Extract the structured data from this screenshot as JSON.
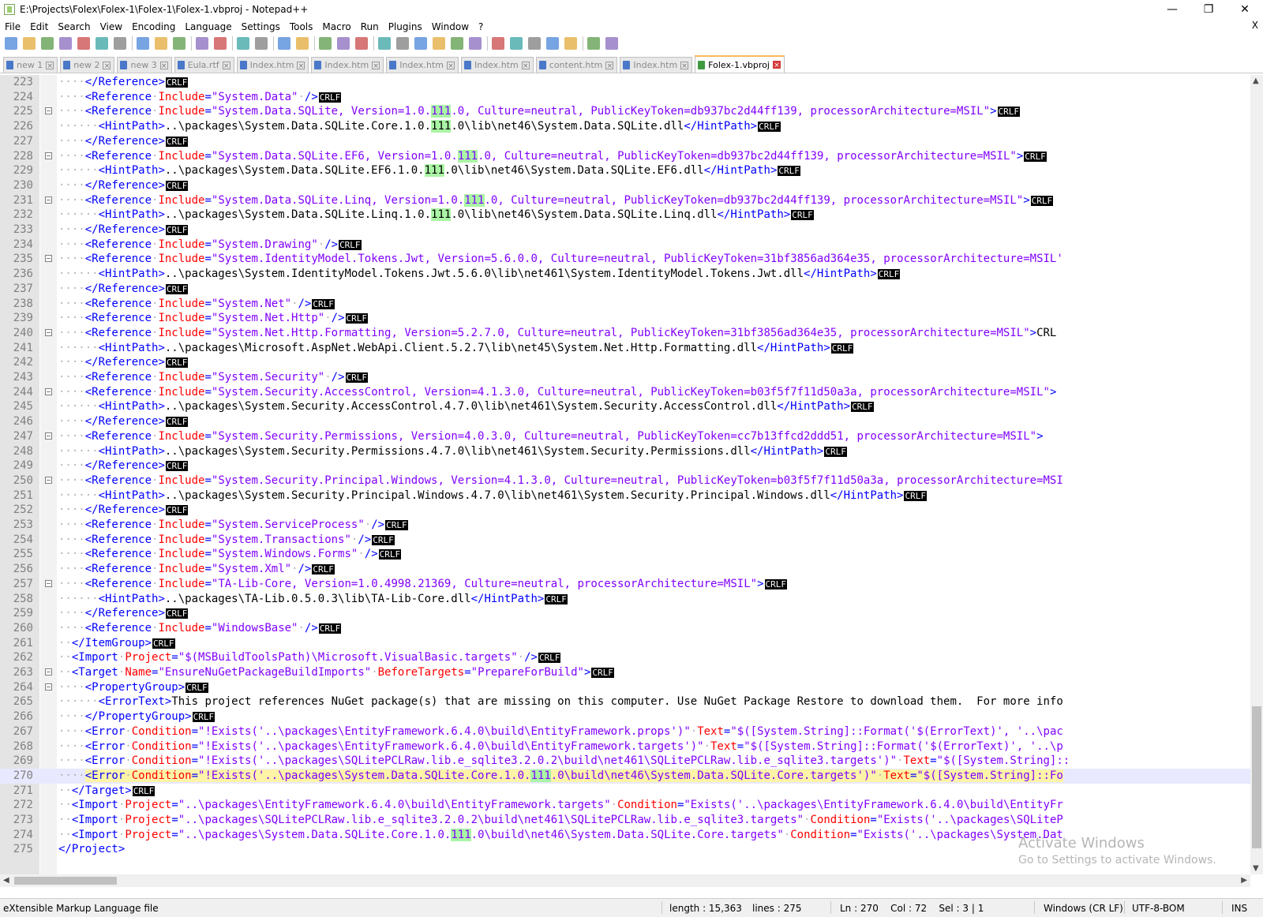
{
  "window": {
    "title": "E:\\Projects\\Folex\\Folex-1\\Folex-1\\Folex-1.vbproj - Notepad++",
    "minimize": "—",
    "maximize": "❐",
    "close": "✕"
  },
  "menu": {
    "items": [
      "File",
      "Edit",
      "Search",
      "View",
      "Encoding",
      "Language",
      "Settings",
      "Tools",
      "Macro",
      "Run",
      "Plugins",
      "Window",
      "?"
    ],
    "close_doc": "X"
  },
  "toolbar": {
    "icons": [
      "new-file-icon",
      "open-file-icon",
      "save-icon",
      "save-all-icon",
      "close-icon",
      "close-all-icon",
      "print-icon",
      "cut-icon",
      "copy-icon",
      "paste-icon",
      "undo-icon",
      "redo-icon",
      "find-icon",
      "replace-icon",
      "zoom-in-icon",
      "zoom-out-icon",
      "sync-vertical-icon",
      "sync-horizontal-icon",
      "word-wrap-icon",
      "show-all-chars-icon",
      "indent-guide-icon",
      "doc-map-icon",
      "function-list-icon",
      "folder-workspace-icon",
      "monitor-icon",
      "record-macro-icon",
      "stop-macro-icon",
      "play-macro-icon",
      "run-macro-multiple-icon",
      "save-macro-icon",
      "spellcheck-icon",
      "spellcheck-settings-icon"
    ]
  },
  "tabs": [
    {
      "label": "new 1",
      "active": false
    },
    {
      "label": "new 2",
      "active": false
    },
    {
      "label": "new 3",
      "active": false
    },
    {
      "label": "Eula.rtf",
      "active": false
    },
    {
      "label": "Index.htm",
      "active": false
    },
    {
      "label": "Index.htm",
      "active": false
    },
    {
      "label": "Index.htm",
      "active": false
    },
    {
      "label": "Index.htm",
      "active": false
    },
    {
      "label": "content.htm",
      "active": false
    },
    {
      "label": "Index.htm",
      "active": false
    },
    {
      "label": "Folex-1.vbproj",
      "active": true
    }
  ],
  "colors": {
    "tag": "#0000ff",
    "attr": "#ff0000",
    "value": "#8000ff",
    "text": "#000000",
    "whitespace_dot": "#b4b4b4",
    "eol_bg": "#000000",
    "eol_fg": "#ffffff",
    "smart_highlight": "#aaf5a5",
    "current_line": "#e8e8ff",
    "selection": "#fdf4a8"
  },
  "editor": {
    "current_line": 270,
    "lines": [
      {
        "n": 223,
        "fold": false,
        "ws": "....",
        "code": "</Reference>",
        "eol": true
      },
      {
        "n": 224,
        "fold": false,
        "ws": "....",
        "code": "<Reference Include=\"System.Data\" />",
        "eol": true
      },
      {
        "n": 225,
        "fold": true,
        "ws": "....",
        "code": "<Reference Include=\"System.Data.SQLite, Version=1.0.111.0, Culture=neutral, PublicKeyToken=db937bc2d44ff139, processorArchitecture=MSIL\">",
        "eol": true
      },
      {
        "n": 226,
        "fold": false,
        "ws": "......",
        "code": "<HintPath>..\\packages\\System.Data.SQLite.Core.1.0.111.0\\lib\\net46\\System.Data.SQLite.dll</HintPath>",
        "eol": true
      },
      {
        "n": 227,
        "fold": false,
        "ws": "....",
        "code": "</Reference>",
        "eol": true
      },
      {
        "n": 228,
        "fold": true,
        "ws": "....",
        "code": "<Reference Include=\"System.Data.SQLite.EF6, Version=1.0.111.0, Culture=neutral, PublicKeyToken=db937bc2d44ff139, processorArchitecture=MSIL\">",
        "eol": true
      },
      {
        "n": 229,
        "fold": false,
        "ws": "......",
        "code": "<HintPath>..\\packages\\System.Data.SQLite.EF6.1.0.111.0\\lib\\net46\\System.Data.SQLite.EF6.dll</HintPath>",
        "eol": true
      },
      {
        "n": 230,
        "fold": false,
        "ws": "....",
        "code": "</Reference>",
        "eol": true
      },
      {
        "n": 231,
        "fold": true,
        "ws": "....",
        "code": "<Reference Include=\"System.Data.SQLite.Linq, Version=1.0.111.0, Culture=neutral, PublicKeyToken=db937bc2d44ff139, processorArchitecture=MSIL\">",
        "eol": true
      },
      {
        "n": 232,
        "fold": false,
        "ws": "......",
        "code": "<HintPath>..\\packages\\System.Data.SQLite.Linq.1.0.111.0\\lib\\net46\\System.Data.SQLite.Linq.dll</HintPath>",
        "eol": true
      },
      {
        "n": 233,
        "fold": false,
        "ws": "....",
        "code": "</Reference>",
        "eol": true
      },
      {
        "n": 234,
        "fold": false,
        "ws": "....",
        "code": "<Reference Include=\"System.Drawing\" />",
        "eol": true
      },
      {
        "n": 235,
        "fold": true,
        "ws": "....",
        "code": "<Reference Include=\"System.IdentityModel.Tokens.Jwt, Version=5.6.0.0, Culture=neutral, PublicKeyToken=31bf3856ad364e35, processorArchitecture=MSIL'",
        "eol": false
      },
      {
        "n": 236,
        "fold": false,
        "ws": "......",
        "code": "<HintPath>..\\packages\\System.IdentityModel.Tokens.Jwt.5.6.0\\lib\\net461\\System.IdentityModel.Tokens.Jwt.dll</HintPath>",
        "eol": true
      },
      {
        "n": 237,
        "fold": false,
        "ws": "....",
        "code": "</Reference>",
        "eol": true
      },
      {
        "n": 238,
        "fold": false,
        "ws": "....",
        "code": "<Reference Include=\"System.Net\" />",
        "eol": true
      },
      {
        "n": 239,
        "fold": false,
        "ws": "....",
        "code": "<Reference Include=\"System.Net.Http\" />",
        "eol": true
      },
      {
        "n": 240,
        "fold": true,
        "ws": "....",
        "code": "<Reference Include=\"System.Net.Http.Formatting, Version=5.2.7.0, Culture=neutral, PublicKeyToken=31bf3856ad364e35, processorArchitecture=MSIL\">CRL",
        "eol": false
      },
      {
        "n": 241,
        "fold": false,
        "ws": "......",
        "code": "<HintPath>..\\packages\\Microsoft.AspNet.WebApi.Client.5.2.7\\lib\\net45\\System.Net.Http.Formatting.dll</HintPath>",
        "eol": true
      },
      {
        "n": 242,
        "fold": false,
        "ws": "....",
        "code": "</Reference>",
        "eol": true
      },
      {
        "n": 243,
        "fold": false,
        "ws": "....",
        "code": "<Reference Include=\"System.Security\" />",
        "eol": true
      },
      {
        "n": 244,
        "fold": true,
        "ws": "....",
        "code": "<Reference Include=\"System.Security.AccessControl, Version=4.1.3.0, Culture=neutral, PublicKeyToken=b03f5f7f11d50a3a, processorArchitecture=MSIL\">",
        "eol": false
      },
      {
        "n": 245,
        "fold": false,
        "ws": "......",
        "code": "<HintPath>..\\packages\\System.Security.AccessControl.4.7.0\\lib\\net461\\System.Security.AccessControl.dll</HintPath>",
        "eol": true
      },
      {
        "n": 246,
        "fold": false,
        "ws": "....",
        "code": "</Reference>",
        "eol": true
      },
      {
        "n": 247,
        "fold": true,
        "ws": "....",
        "code": "<Reference Include=\"System.Security.Permissions, Version=4.0.3.0, Culture=neutral, PublicKeyToken=cc7b13ffcd2ddd51, processorArchitecture=MSIL\">",
        "eol": false
      },
      {
        "n": 248,
        "fold": false,
        "ws": "......",
        "code": "<HintPath>..\\packages\\System.Security.Permissions.4.7.0\\lib\\net461\\System.Security.Permissions.dll</HintPath>",
        "eol": true
      },
      {
        "n": 249,
        "fold": false,
        "ws": "....",
        "code": "</Reference>",
        "eol": true
      },
      {
        "n": 250,
        "fold": true,
        "ws": "....",
        "code": "<Reference Include=\"System.Security.Principal.Windows, Version=4.1.3.0, Culture=neutral, PublicKeyToken=b03f5f7f11d50a3a, processorArchitecture=MSI",
        "eol": false
      },
      {
        "n": 251,
        "fold": false,
        "ws": "......",
        "code": "<HintPath>..\\packages\\System.Security.Principal.Windows.4.7.0\\lib\\net461\\System.Security.Principal.Windows.dll</HintPath>",
        "eol": true
      },
      {
        "n": 252,
        "fold": false,
        "ws": "....",
        "code": "</Reference>",
        "eol": true
      },
      {
        "n": 253,
        "fold": false,
        "ws": "....",
        "code": "<Reference Include=\"System.ServiceProcess\" />",
        "eol": true
      },
      {
        "n": 254,
        "fold": false,
        "ws": "....",
        "code": "<Reference Include=\"System.Transactions\" />",
        "eol": true
      },
      {
        "n": 255,
        "fold": false,
        "ws": "....",
        "code": "<Reference Include=\"System.Windows.Forms\" />",
        "eol": true
      },
      {
        "n": 256,
        "fold": false,
        "ws": "....",
        "code": "<Reference Include=\"System.Xml\" />",
        "eol": true
      },
      {
        "n": 257,
        "fold": true,
        "ws": "....",
        "code": "<Reference Include=\"TA-Lib-Core, Version=1.0.4998.21369, Culture=neutral, processorArchitecture=MSIL\">",
        "eol": true
      },
      {
        "n": 258,
        "fold": false,
        "ws": "......",
        "code": "<HintPath>..\\packages\\TA-Lib.0.5.0.3\\lib\\TA-Lib-Core.dll</HintPath>",
        "eol": true
      },
      {
        "n": 259,
        "fold": false,
        "ws": "....",
        "code": "</Reference>",
        "eol": true
      },
      {
        "n": 260,
        "fold": false,
        "ws": "....",
        "code": "<Reference Include=\"WindowsBase\" />",
        "eol": true
      },
      {
        "n": 261,
        "fold": false,
        "ws": "..",
        "code": "</ItemGroup>",
        "eol": true
      },
      {
        "n": 262,
        "fold": false,
        "ws": "..",
        "code": "<Import Project=\"$(MSBuildToolsPath)\\Microsoft.VisualBasic.targets\" />",
        "eol": true
      },
      {
        "n": 263,
        "fold": true,
        "ws": "..",
        "code": "<Target Name=\"EnsureNuGetPackageBuildImports\" BeforeTargets=\"PrepareForBuild\">",
        "eol": true
      },
      {
        "n": 264,
        "fold": true,
        "ws": "....",
        "code": "<PropertyGroup>",
        "eol": true
      },
      {
        "n": 265,
        "fold": false,
        "ws": "......",
        "code": "<ErrorText>This project references NuGet package(s) that are missing on this computer. Use NuGet Package Restore to download them.  For more info",
        "eol": false
      },
      {
        "n": 266,
        "fold": false,
        "ws": "....",
        "code": "</PropertyGroup>",
        "eol": true
      },
      {
        "n": 267,
        "fold": false,
        "ws": "....",
        "code": "<Error Condition=\"!Exists('..\\packages\\EntityFramework.6.4.0\\build\\EntityFramework.props')\" Text=\"$([System.String]::Format('$(ErrorText)', '..\\pac",
        "eol": false
      },
      {
        "n": 268,
        "fold": false,
        "ws": "....",
        "code": "<Error Condition=\"!Exists('..\\packages\\EntityFramework.6.4.0\\build\\EntityFramework.targets')\" Text=\"$([System.String]::Format('$(ErrorText)', '..\\p",
        "eol": false
      },
      {
        "n": 269,
        "fold": false,
        "ws": "....",
        "code": "<Error Condition=\"!Exists('..\\packages\\SQLitePCLRaw.lib.e_sqlite3.2.0.2\\build\\net461\\SQLitePCLRaw.lib.e_sqlite3.targets')\" Text=\"$([System.String]::",
        "eol": false
      },
      {
        "n": 270,
        "fold": false,
        "ws": "....",
        "code": "<Error Condition=\"!Exists('..\\packages\\System.Data.SQLite.Core.1.0.111.0\\build\\net46\\System.Data.SQLite.Core.targets')\" Text=\"$([System.String]::Fo",
        "eol": false
      },
      {
        "n": 271,
        "fold": false,
        "ws": "..",
        "code": "</Target>",
        "eol": true
      },
      {
        "n": 272,
        "fold": false,
        "ws": "..",
        "code": "<Import Project=\"..\\packages\\EntityFramework.6.4.0\\build\\EntityFramework.targets\" Condition=\"Exists('..\\packages\\EntityFramework.6.4.0\\build\\EntityFr",
        "eol": false
      },
      {
        "n": 273,
        "fold": false,
        "ws": "..",
        "code": "<Import Project=\"..\\packages\\SQLitePCLRaw.lib.e_sqlite3.2.0.2\\build\\net461\\SQLitePCLRaw.lib.e_sqlite3.targets\" Condition=\"Exists('..\\packages\\SQLiteP",
        "eol": false
      },
      {
        "n": 274,
        "fold": false,
        "ws": "..",
        "code": "<Import Project=\"..\\packages\\System.Data.SQLite.Core.1.0.111.0\\build\\net46\\System.Data.SQLite.Core.targets\" Condition=\"Exists('..\\packages\\System.Dat",
        "eol": false
      },
      {
        "n": 275,
        "fold": false,
        "ws": "",
        "code": "</Project>",
        "eol": false
      }
    ],
    "eol_label": "CRLF",
    "highlight_token": "111"
  },
  "watermark": {
    "line1": "Activate Windows",
    "line2": "Go to Settings to activate Windows."
  },
  "status": {
    "filetype": "eXtensible Markup Language file",
    "length": "length : 15,363",
    "lines": "lines : 275",
    "position": "Ln : 270    Col : 72    Sel : 3 | 1",
    "eol": "Windows (CR LF)",
    "encoding": "UTF-8-BOM",
    "mode": "INS"
  }
}
